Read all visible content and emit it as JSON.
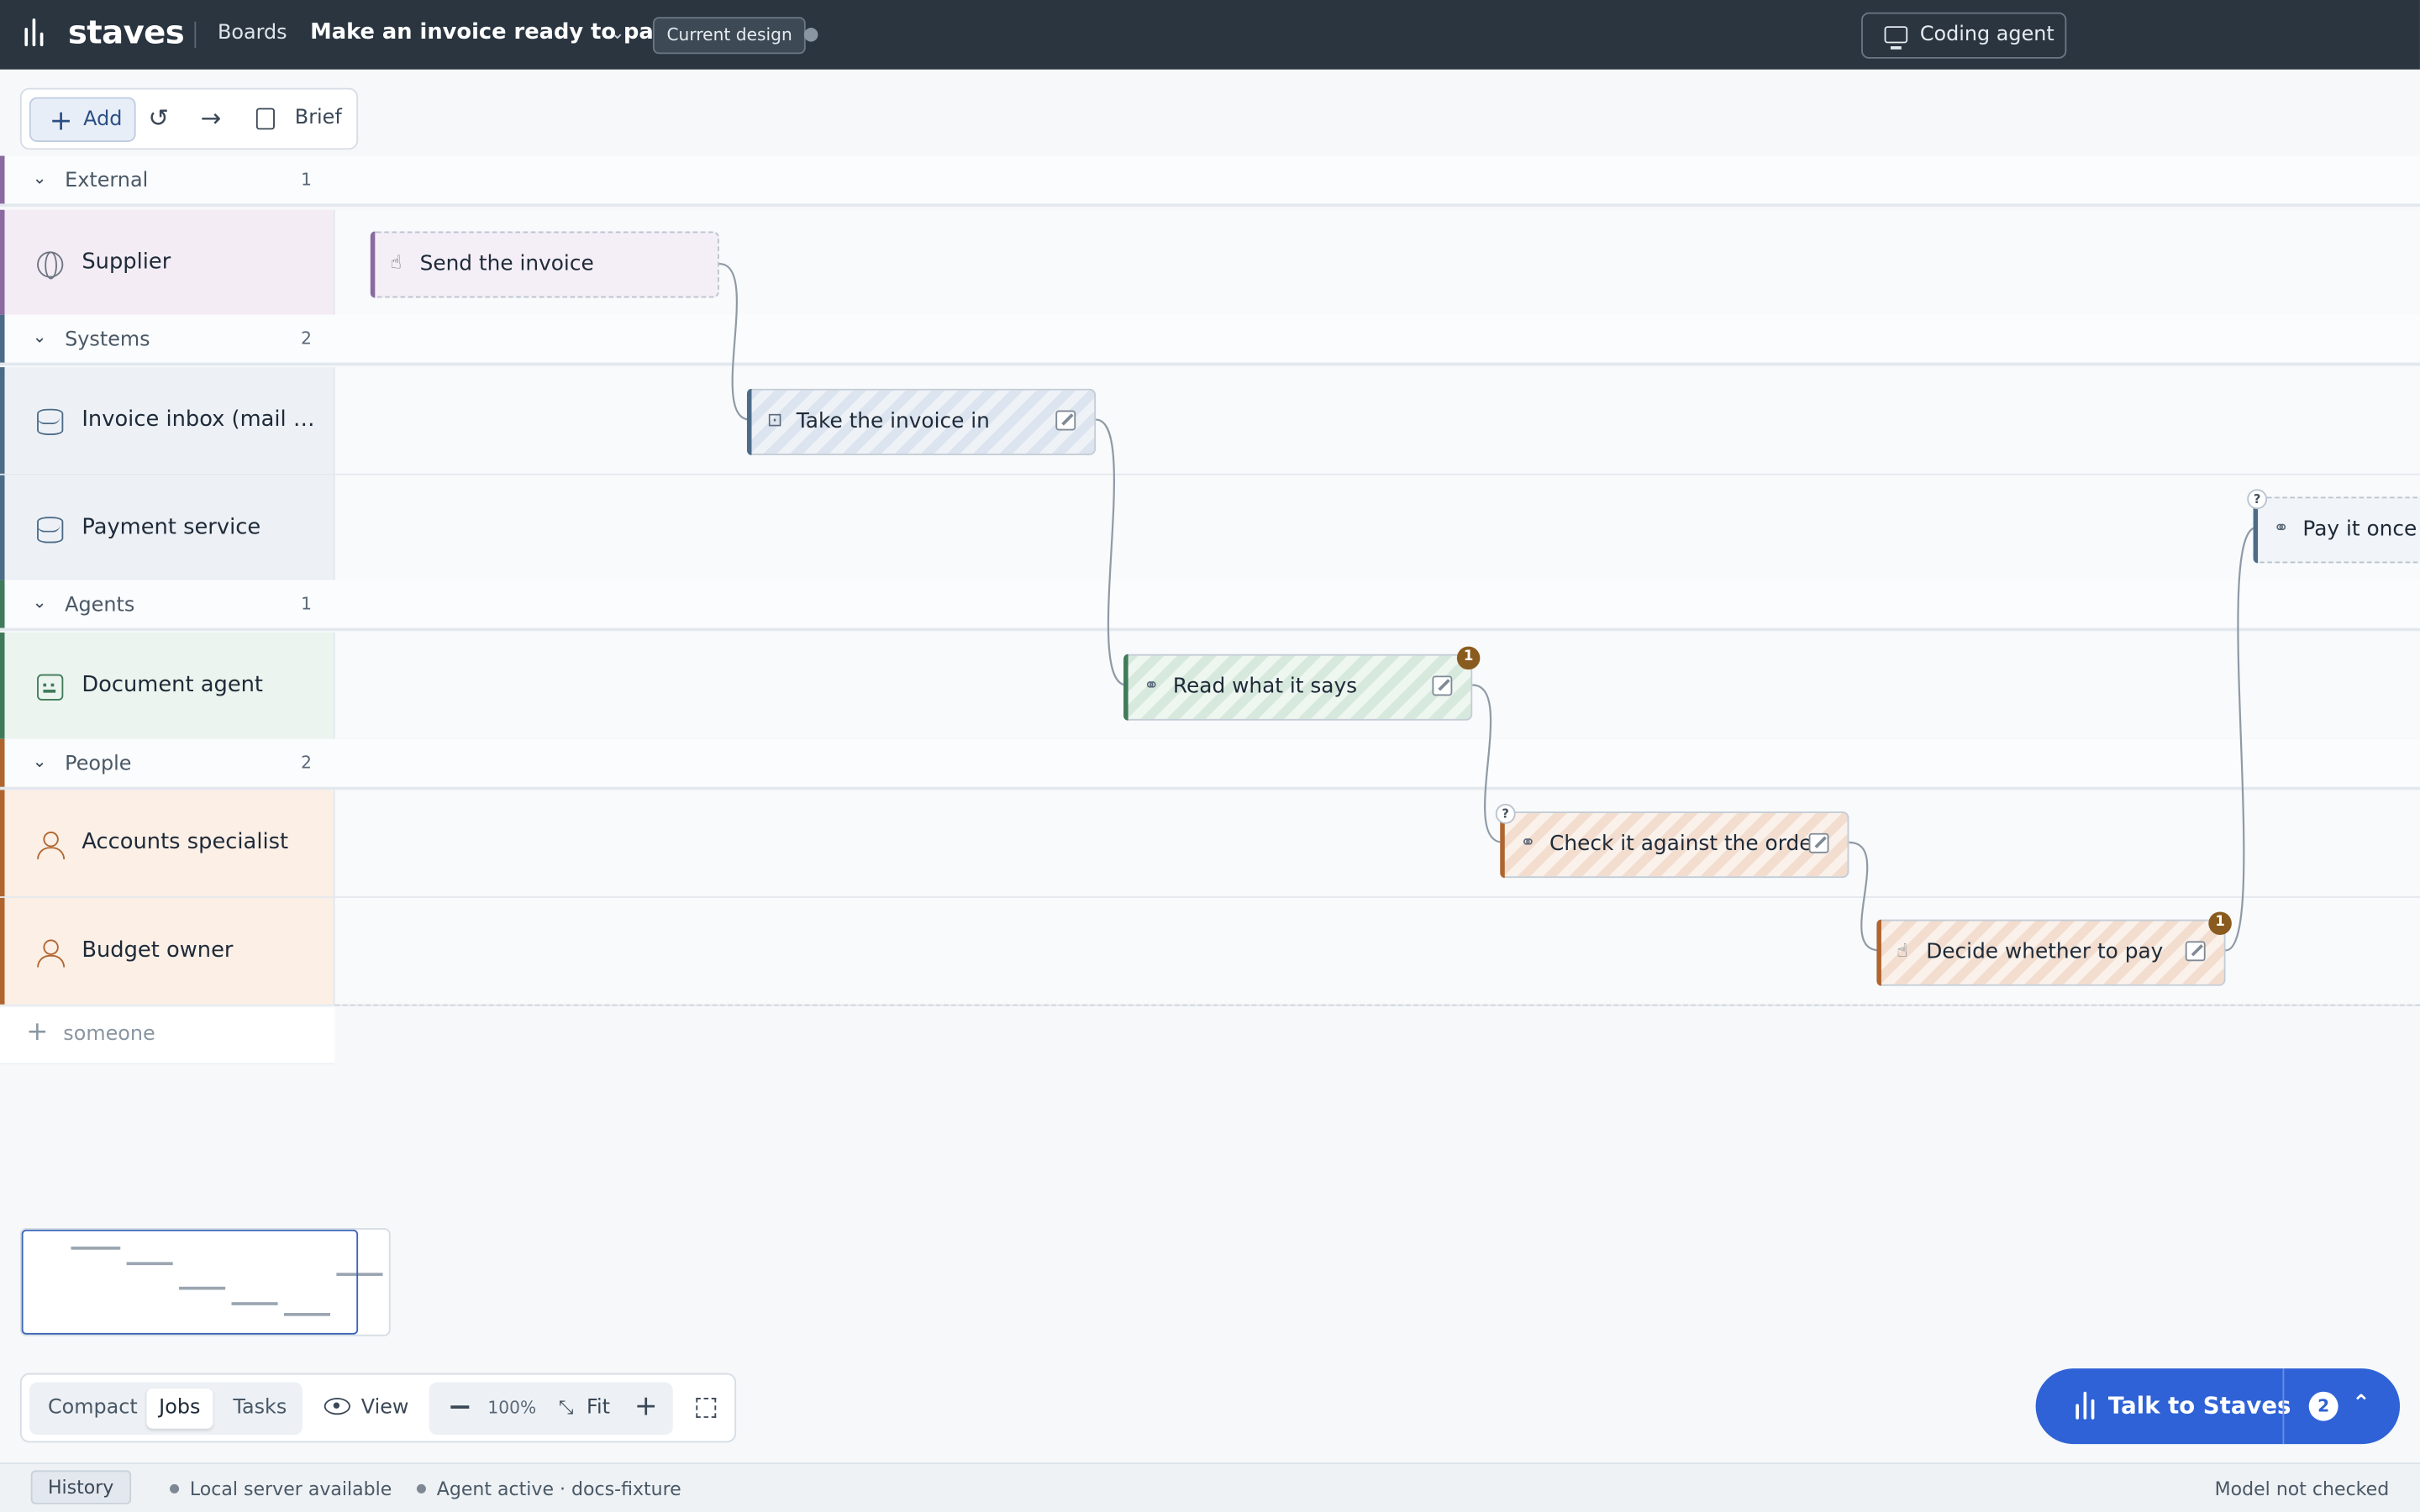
{
  "app": {
    "brand": "staves"
  },
  "header": {
    "boards": "Boards",
    "board_title": "Make an invoice ready to pay",
    "design_badge": "Current design",
    "coding_agent": "Coding agent"
  },
  "toolbar": {
    "add": "Add",
    "brief": "Brief"
  },
  "groups": [
    {
      "name": "External",
      "count": "1"
    },
    {
      "name": "Systems",
      "count": "2"
    },
    {
      "name": "Agents",
      "count": "1"
    },
    {
      "name": "People",
      "count": "2"
    }
  ],
  "lanes": [
    {
      "name": "Supplier",
      "icon": "globe-icon"
    },
    {
      "name": "Invoice inbox (mail and upload)",
      "icon": "database-icon"
    },
    {
      "name": "Payment service",
      "icon": "database-icon"
    },
    {
      "name": "Document agent",
      "icon": "robot-icon"
    },
    {
      "name": "Accounts specialist",
      "icon": "person-icon"
    },
    {
      "name": "Budget owner",
      "icon": "person-icon"
    }
  ],
  "add_lane": "someone",
  "cards": [
    {
      "title": "Send the invoice",
      "icon": "hand-icon"
    },
    {
      "title": "Take the invoice in",
      "icon": "inbox-icon"
    },
    {
      "title": "Read what it says",
      "icon": "link-icon",
      "badge": "1"
    },
    {
      "title": "Check it against the order",
      "icon": "link-icon",
      "badge": "?"
    },
    {
      "title": "Decide whether to pay",
      "icon": "hand-icon",
      "badge": "1"
    },
    {
      "title": "Pay it once",
      "icon": "link-icon",
      "badge": "?"
    }
  ],
  "view": {
    "modes": [
      "Compact",
      "Jobs",
      "Tasks"
    ],
    "active_mode": "Jobs",
    "view_label": "View",
    "zoom": "100%",
    "fit": "Fit"
  },
  "talk": {
    "label": "Talk to Staves",
    "count": "2"
  },
  "status": {
    "history": "History",
    "server": "Local server available",
    "agent": "Agent active · docs-fixture",
    "model": "Model not checked"
  },
  "colors": {
    "topbar": "#2a3540",
    "primary": "#2f62d6",
    "external": "#8a6aa0",
    "systems": "#4b6b88",
    "agents": "#3f7a5a",
    "people": "#b0652e",
    "badge": "#8a5b1e"
  }
}
